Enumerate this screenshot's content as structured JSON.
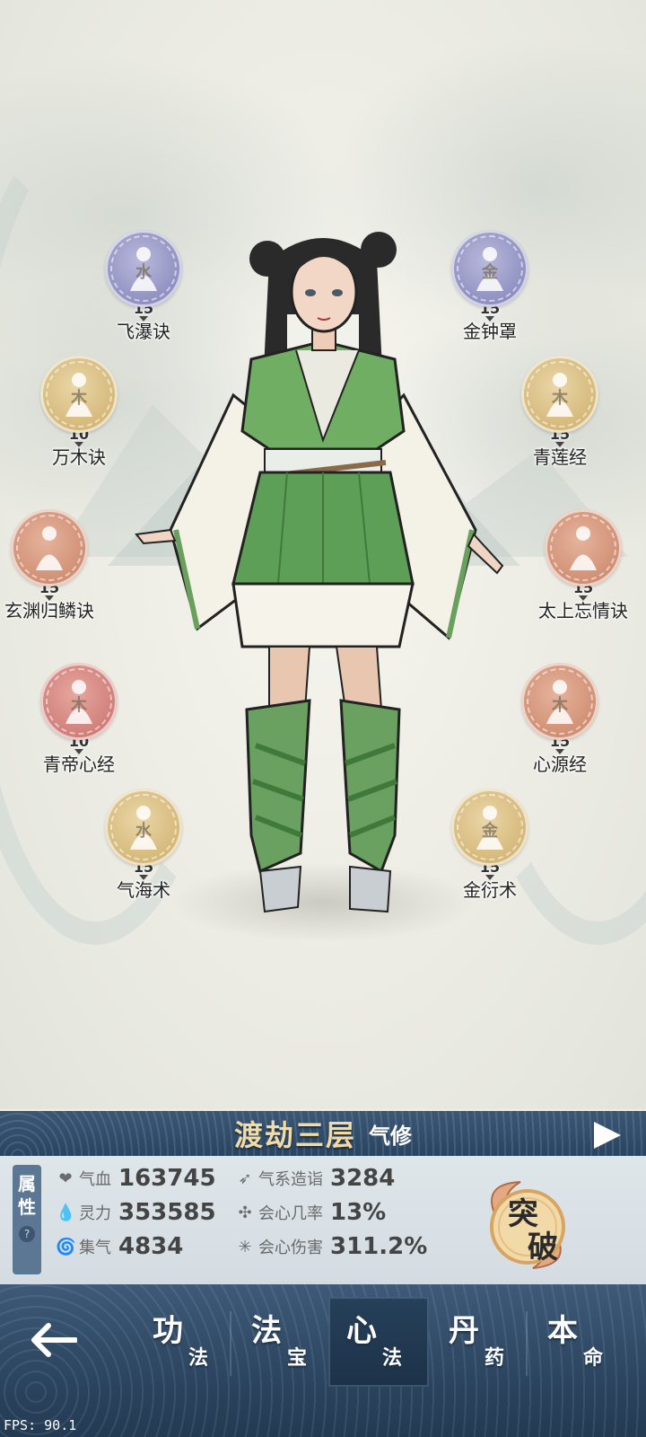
{
  "skills": {
    "left": [
      {
        "name": "飞瀑诀",
        "level": "15",
        "element": "水",
        "color": "blue"
      },
      {
        "name": "万木诀",
        "level": "10",
        "element": "木",
        "color": "gold"
      },
      {
        "name": "玄渊归鳞诀",
        "level": "15",
        "element": "",
        "color": "copper"
      },
      {
        "name": "青帝心经",
        "level": "10",
        "element": "木",
        "color": "red"
      },
      {
        "name": "气海术",
        "level": "15",
        "element": "水",
        "color": "gold"
      }
    ],
    "right": [
      {
        "name": "金钟罩",
        "level": "15",
        "element": "金",
        "color": "blue"
      },
      {
        "name": "青莲经",
        "level": "15",
        "element": "木",
        "color": "gold"
      },
      {
        "name": "太上忘情诀",
        "level": "15",
        "element": "",
        "color": "copper"
      },
      {
        "name": "心源经",
        "level": "15",
        "element": "木",
        "color": "copper"
      },
      {
        "name": "金衍术",
        "level": "15",
        "element": "金",
        "color": "gold"
      }
    ]
  },
  "realm": {
    "title": "渡劫三层",
    "type": "气修"
  },
  "attributes": {
    "tab_label_1": "属",
    "tab_label_2": "性",
    "help_icon": "?",
    "left": [
      {
        "label": "气血",
        "value": "163745",
        "icon": "heart-icon"
      },
      {
        "label": "灵力",
        "value": "353585",
        "icon": "droplet-icon"
      },
      {
        "label": "集气",
        "value": "4834",
        "icon": "swirl-icon"
      }
    ],
    "right": [
      {
        "label": "气系造诣",
        "value": "3284",
        "icon": "wing-icon"
      },
      {
        "label": "会心几率",
        "value": "13%",
        "icon": "critical-icon"
      },
      {
        "label": "会心伤害",
        "value": "311.2%",
        "icon": "burst-icon"
      }
    ]
  },
  "breakthrough": {
    "char1": "突",
    "char2": "破"
  },
  "nav": {
    "tabs": [
      {
        "big": "功",
        "small": "法"
      },
      {
        "big": "法",
        "small": "宝"
      },
      {
        "big": "心",
        "small": "法"
      },
      {
        "big": "丹",
        "small": "药"
      },
      {
        "big": "本",
        "small": "命"
      }
    ],
    "active_index": 2
  },
  "fps": "FPS: 90.1",
  "colors": {
    "orb_blue": "#8e8ec0",
    "orb_gold": "#d4b777",
    "orb_copper": "#cf8e72",
    "orb_red": "#cf7d77",
    "realm_gold": "#f1dba6",
    "panel_blue": "#3b5775"
  }
}
